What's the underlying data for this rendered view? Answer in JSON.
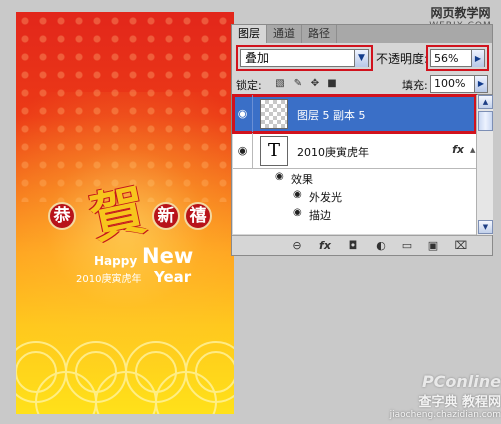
{
  "canvas": {
    "seals": [
      "恭",
      "新",
      "禧"
    ],
    "big_char": "賀",
    "happy": "Happy",
    "new": "New",
    "year": "Year",
    "line_2010": "2010庚寅虎年"
  },
  "watermark_top": {
    "line1": "网页教学网",
    "line2": "WEBJX.COM"
  },
  "watermark_bottom": {
    "brand": "PConline",
    "site": "查字典 教程网",
    "url": "jiaocheng.chazidian.com"
  },
  "panel": {
    "tabs": [
      {
        "label": "图层",
        "active": true
      },
      {
        "label": "通道",
        "active": false
      },
      {
        "label": "路径",
        "active": false
      }
    ],
    "blend_mode": "叠加",
    "opacity_label": "不透明度:",
    "opacity_value": "56%",
    "lock_label": "锁定:",
    "fill_label": "填充:",
    "fill_value": "100%",
    "layers": [
      {
        "name": "图层 5 副本 5",
        "selected": true,
        "thumb": "transparent",
        "eye_icon": "eye-icon"
      },
      {
        "name": "2010庚寅虎年",
        "selected": false,
        "thumb": "T",
        "fx": "fx",
        "eye_icon": "eye-icon"
      }
    ],
    "effects": {
      "label": "效果",
      "items": [
        "外发光",
        "描边"
      ]
    },
    "bottom_icons": [
      "link-icon",
      "fx-icon",
      "mask-icon",
      "adjustment-icon",
      "group-icon",
      "new-layer-icon",
      "trash-icon"
    ]
  },
  "colors": {
    "highlight_red": "#d1121d",
    "selection_blue": "#3a6fc7"
  }
}
